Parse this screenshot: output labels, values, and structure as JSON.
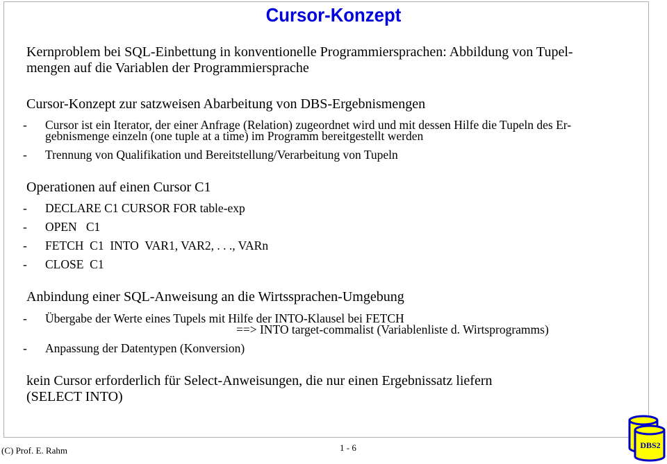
{
  "title": "Cursor-Konzept",
  "intro": [
    "Kernproblem bei SQL-Einbettung in konventionelle Programmiersprachen: Abbildung von Tupel-",
    "mengen auf die Variablen der Programmiersprache"
  ],
  "section1": {
    "heading": "Cursor-Konzept zur satzweisen Abarbeitung von DBS-Ergebnismengen",
    "bullets": [
      [
        "Cursor ist ein Iterator, der einer Anfrage (Relation) zugeordnet wird und mit dessen Hilfe die Tupeln des Er-",
        "gebnismenge einzeln (one tuple at a time) im Programm bereitgestellt werden"
      ],
      [
        "Trennung von Qualifikation und Bereitstellung/Verarbeitung von Tupeln"
      ]
    ]
  },
  "section2": {
    "heading": "Operationen auf einen Cursor C1",
    "bullets": [
      "DECLARE C1 CURSOR FOR table-exp",
      "OPEN   C1",
      "FETCH  C1  INTO  VAR1, VAR2, . . ., VARn",
      "CLOSE  C1"
    ]
  },
  "section3": {
    "heading": "Anbindung einer SQL-Anweisung an die Wirtssprachen-Umgebung",
    "bullets": [
      [
        "Übergabe der Werte eines Tupels mit Hilfe der INTO-Klausel bei FETCH",
        "==> INTO target-commalist (Variablenliste d. Wirtsprogramms)"
      ],
      [
        "Anpassung der Datentypen (Konversion)"
      ]
    ]
  },
  "closing": [
    "kein Cursor erforderlich für Select-Anweisungen, die nur einen Ergebnissatz liefern",
    "(SELECT INTO)"
  ],
  "bullet_marker": "-",
  "footer": {
    "copyright": "(C) Prof. E. Rahm",
    "page": "1 - 6",
    "logo": "DBS2"
  },
  "colors": {
    "title": "#0000dd",
    "logo_fill": "#ffff00",
    "logo_stroke": "#0000cc"
  }
}
